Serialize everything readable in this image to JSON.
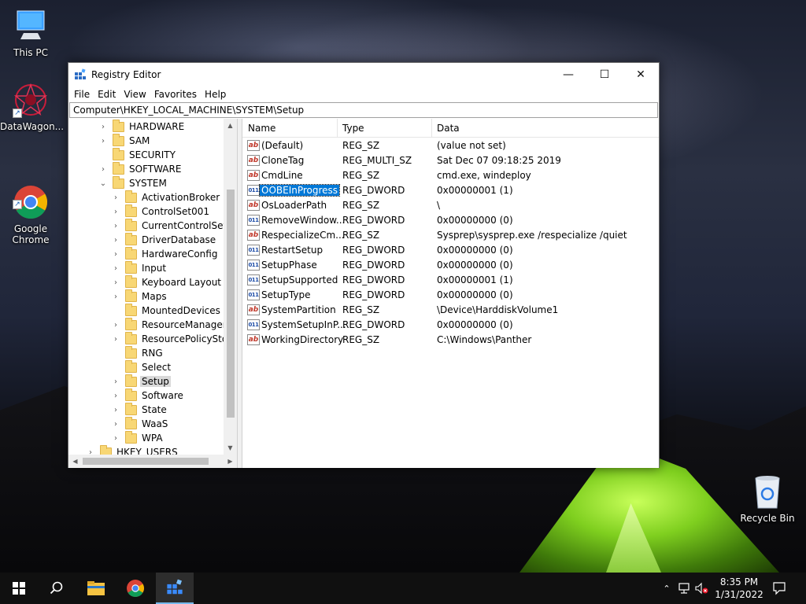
{
  "desktop": {
    "icons": [
      {
        "name": "this-pc",
        "label": "This PC"
      },
      {
        "name": "datawagon",
        "label": "DataWagon..."
      },
      {
        "name": "google-chrome",
        "label": "Google\nChrome"
      },
      {
        "name": "recycle-bin",
        "label": "Recycle Bin"
      }
    ]
  },
  "window": {
    "title": "Registry Editor",
    "controls": {
      "minimize": "—",
      "maximize": "☐",
      "close": "✕"
    },
    "menu": [
      "File",
      "Edit",
      "View",
      "Favorites",
      "Help"
    ],
    "address": "Computer\\HKEY_LOCAL_MACHINE\\SYSTEM\\Setup"
  },
  "tree": {
    "items": [
      {
        "label": "HARDWARE",
        "chevron": "›",
        "level": 1
      },
      {
        "label": "SAM",
        "chevron": "›",
        "level": 1
      },
      {
        "label": "SECURITY",
        "chevron": "",
        "level": 1
      },
      {
        "label": "SOFTWARE",
        "chevron": "›",
        "level": 1
      },
      {
        "label": "SYSTEM",
        "chevron": "⌄",
        "level": 1
      },
      {
        "label": "ActivationBroker",
        "chevron": "›",
        "level": 2
      },
      {
        "label": "ControlSet001",
        "chevron": "›",
        "level": 2
      },
      {
        "label": "CurrentControlSet",
        "chevron": "›",
        "level": 2
      },
      {
        "label": "DriverDatabase",
        "chevron": "›",
        "level": 2
      },
      {
        "label": "HardwareConfig",
        "chevron": "›",
        "level": 2
      },
      {
        "label": "Input",
        "chevron": "›",
        "level": 2
      },
      {
        "label": "Keyboard Layout",
        "chevron": "›",
        "level": 2
      },
      {
        "label": "Maps",
        "chevron": "›",
        "level": 2
      },
      {
        "label": "MountedDevices",
        "chevron": "",
        "level": 2
      },
      {
        "label": "ResourceManager",
        "chevron": "›",
        "level": 2
      },
      {
        "label": "ResourcePolicyStore",
        "chevron": "›",
        "level": 2
      },
      {
        "label": "RNG",
        "chevron": "",
        "level": 2
      },
      {
        "label": "Select",
        "chevron": "",
        "level": 2
      },
      {
        "label": "Setup",
        "chevron": "›",
        "level": 2,
        "selected": true
      },
      {
        "label": "Software",
        "chevron": "›",
        "level": 2
      },
      {
        "label": "State",
        "chevron": "›",
        "level": 2
      },
      {
        "label": "WaaS",
        "chevron": "›",
        "level": 2
      },
      {
        "label": "WPA",
        "chevron": "›",
        "level": 2
      },
      {
        "label": "HKEY_USERS",
        "chevron": "›",
        "level": 0
      }
    ]
  },
  "values": {
    "headers": {
      "name": "Name",
      "type": "Type",
      "data": "Data"
    },
    "rows": [
      {
        "icon": "ab",
        "kind": "sz",
        "name": "(Default)",
        "type": "REG_SZ",
        "data": "(value not set)"
      },
      {
        "icon": "ab",
        "kind": "sz",
        "name": "CloneTag",
        "type": "REG_MULTI_SZ",
        "data": "Sat Dec 07 09:18:25 2019"
      },
      {
        "icon": "ab",
        "kind": "sz",
        "name": "CmdLine",
        "type": "REG_SZ",
        "data": "cmd.exe, windeploy"
      },
      {
        "icon": "011",
        "kind": "bin",
        "name": "OOBEInProgress",
        "type": "REG_DWORD",
        "data": "0x00000001 (1)",
        "selected": true
      },
      {
        "icon": "ab",
        "kind": "sz",
        "name": "OsLoaderPath",
        "type": "REG_SZ",
        "data": "\\"
      },
      {
        "icon": "011",
        "kind": "bin",
        "name": "RemoveWindow...",
        "type": "REG_DWORD",
        "data": "0x00000000 (0)"
      },
      {
        "icon": "ab",
        "kind": "sz",
        "name": "RespecializeCm...",
        "type": "REG_SZ",
        "data": "Sysprep\\sysprep.exe /respecialize /quiet"
      },
      {
        "icon": "011",
        "kind": "bin",
        "name": "RestartSetup",
        "type": "REG_DWORD",
        "data": "0x00000000 (0)"
      },
      {
        "icon": "011",
        "kind": "bin",
        "name": "SetupPhase",
        "type": "REG_DWORD",
        "data": "0x00000000 (0)"
      },
      {
        "icon": "011",
        "kind": "bin",
        "name": "SetupSupported",
        "type": "REG_DWORD",
        "data": "0x00000001 (1)"
      },
      {
        "icon": "011",
        "kind": "bin",
        "name": "SetupType",
        "type": "REG_DWORD",
        "data": "0x00000000 (0)"
      },
      {
        "icon": "ab",
        "kind": "sz",
        "name": "SystemPartition",
        "type": "REG_SZ",
        "data": "\\Device\\HarddiskVolume1"
      },
      {
        "icon": "011",
        "kind": "bin",
        "name": "SystemSetupInP...",
        "type": "REG_DWORD",
        "data": "0x00000000 (0)"
      },
      {
        "icon": "ab",
        "kind": "sz",
        "name": "WorkingDirectory",
        "type": "REG_SZ",
        "data": "C:\\Windows\\Panther"
      }
    ]
  },
  "taskbar": {
    "time": "8:35 PM",
    "date": "1/31/2022",
    "colors": {
      "background": "#101010",
      "accent": "#0078d7"
    }
  }
}
